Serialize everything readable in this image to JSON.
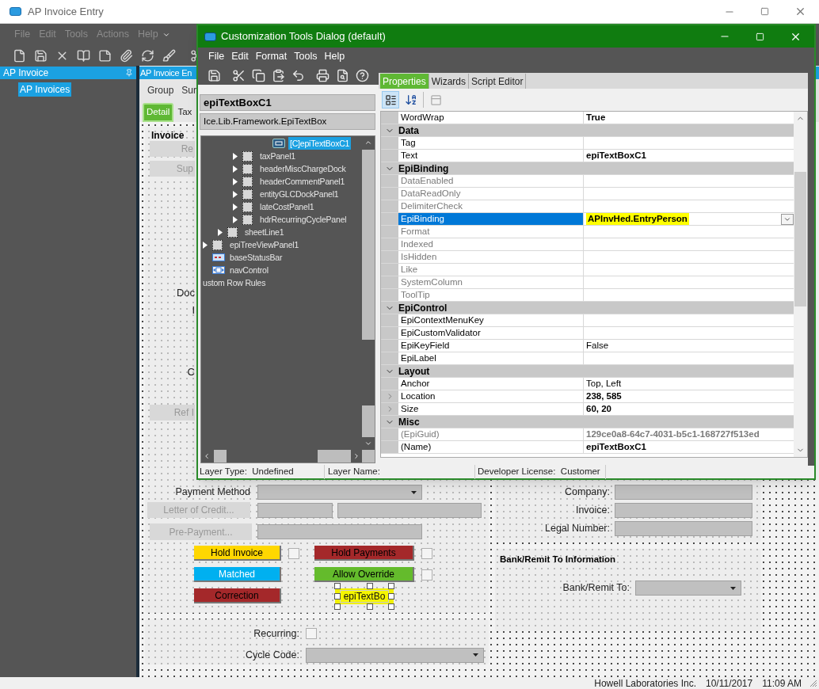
{
  "app_window": {
    "title": "AP Invoice Entry",
    "menu": [
      "File",
      "Edit",
      "Tools",
      "Actions",
      "Help"
    ]
  },
  "navigator": {
    "title": "AP Invoice",
    "items": [
      {
        "label": "AP Invoices",
        "selected": true
      }
    ]
  },
  "form": {
    "title": "AP Invoice En",
    "toolbar": [
      "Group",
      "Sur"
    ],
    "tabs": [
      {
        "label": "Detail",
        "selected": true
      },
      {
        "label": "Tax",
        "selected": false
      }
    ],
    "invoice_group": {
      "title": "Invoice",
      "top_buttons": [
        "Re",
        "Sup"
      ],
      "labels": [
        "Doc",
        "I",
        "C"
      ],
      "bottom_button": "Ref I"
    },
    "payment_method": {
      "label": "Payment Method"
    },
    "letter_of_credit": {
      "label": "Letter of Credit..."
    },
    "pre_payment": {
      "label": "Pre-Payment..."
    },
    "status_buttons": [
      {
        "label": "Hold Invoice",
        "color": "#ffd700",
        "kind": "with-checkbox",
        "checked": false
      },
      {
        "label": "Hold Payments",
        "color": "#a4282a",
        "kind": "with-checkbox",
        "checked": false
      },
      {
        "label": "Matched",
        "color": "#00b0f0",
        "kind": "plain"
      },
      {
        "label": "Allow Override",
        "color": "#64bb2c",
        "kind": "with-checkbox",
        "checked": false
      },
      {
        "label": "Correction",
        "color": "#a4282a",
        "kind": "plain"
      }
    ],
    "designer_textbox": {
      "text": "epiTextBo",
      "selected": true,
      "highlighted": true
    },
    "recurring": {
      "label": "Recurring:",
      "checked": false
    },
    "cycle_code": {
      "label": "Cycle Code:"
    },
    "references": [
      {
        "label": "Company:"
      },
      {
        "label": "Invoice:"
      },
      {
        "label": "Legal Number:"
      }
    ],
    "bank_remit": {
      "title": "Bank/Remit To Information",
      "label": "Bank/Remit To:"
    }
  },
  "status_bar": [
    "Howell Laboratories Inc.",
    "10/11/2017",
    "11:09 AM"
  ],
  "dialog": {
    "title": "Customization Tools Dialog (default)",
    "menu": [
      "File",
      "Edit",
      "Format",
      "Tools",
      "Help"
    ],
    "control_name": "epiTextBoxC1",
    "control_type": "Ice.Lib.Framework.EpiTextBox",
    "tree": [
      {
        "children": [
          {
            "children": [
              {
                "children": [
                  {
                    "children": [
                      {
                        "children": [
                          {
                            "label": "[C]epiTextBoxC1",
                            "kind": "textbox",
                            "expandable": false,
                            "selected": true
                          }
                        ]
                      }
                    ]
                  },
                  {
                    "label": "taxPanel1",
                    "kind": "panel",
                    "expandable": true,
                    "selected": false
                  },
                  {
                    "label": "headerMiscChargeDock",
                    "kind": "panel",
                    "expandable": true,
                    "selected": false
                  },
                  {
                    "label": "headerCommentPanel1",
                    "kind": "panel",
                    "expandable": true,
                    "selected": false
                  },
                  {
                    "label": "entityGLCDockPanel1",
                    "kind": "panel",
                    "expandable": true,
                    "selected": false
                  },
                  {
                    "label": "lateCostPanel1",
                    "kind": "panel",
                    "expandable": true,
                    "selected": false
                  },
                  {
                    "label": "hdrRecurringCyclePanel",
                    "kind": "panel",
                    "expandable": true,
                    "selected": false
                  }
                ]
              },
              {
                "label": "sheetLine1",
                "kind": "panel",
                "expandable": true,
                "selected": false
              }
            ]
          },
          {
            "label": "epiTreeViewPanel1",
            "kind": "panel",
            "expandable": true,
            "selected": false
          },
          {
            "label": "baseStatusBar",
            "kind": "statusbar",
            "expandable": false,
            "selected": false
          },
          {
            "label": "navControl",
            "kind": "navigator",
            "expandable": false,
            "selected": false
          }
        ]
      },
      {
        "label": "ustom Row Rules",
        "kind": "rules",
        "expandable": false,
        "selected": false
      }
    ],
    "tabs": [
      {
        "label": "Properties",
        "selected": true
      },
      {
        "label": "Wizards",
        "selected": false
      },
      {
        "label": "Script Editor",
        "selected": false
      }
    ],
    "properties": [
      {
        "kind": "property",
        "name": "WordWrap",
        "value": "True",
        "dimmed": false,
        "bold": true,
        "expandable": false,
        "selected": false,
        "highlighted": false
      },
      {
        "kind": "category",
        "name": "Data"
      },
      {
        "kind": "property",
        "name": "Tag",
        "dimmed": false,
        "expandable": false,
        "selected": false
      },
      {
        "kind": "property",
        "name": "Text",
        "value": "epiTextBoxC1",
        "dimmed": false,
        "bold": true,
        "expandable": false,
        "selected": false,
        "highlighted": false
      },
      {
        "kind": "category",
        "name": "EpiBinding"
      },
      {
        "kind": "property",
        "name": "DataEnabled",
        "dimmed": true,
        "expandable": false,
        "selected": false
      },
      {
        "kind": "property",
        "name": "DataReadOnly",
        "dimmed": true,
        "expandable": false,
        "selected": false
      },
      {
        "kind": "property",
        "name": "DelimiterCheck",
        "dimmed": true,
        "expandable": false,
        "selected": false
      },
      {
        "kind": "property",
        "name": "EpiBinding",
        "value": "APInvHed.EntryPerson",
        "dimmed": false,
        "bold": true,
        "expandable": false,
        "selected": true,
        "highlighted": true
      },
      {
        "kind": "property",
        "name": "Format",
        "dimmed": true,
        "expandable": false,
        "selected": false
      },
      {
        "kind": "property",
        "name": "Indexed",
        "dimmed": true,
        "expandable": false,
        "selected": false
      },
      {
        "kind": "property",
        "name": "IsHidden",
        "dimmed": true,
        "expandable": false,
        "selected": false
      },
      {
        "kind": "property",
        "name": "Like",
        "dimmed": true,
        "expandable": false,
        "selected": false
      },
      {
        "kind": "property",
        "name": "SystemColumn",
        "dimmed": true,
        "expandable": false,
        "selected": false
      },
      {
        "kind": "property",
        "name": "ToolTip",
        "dimmed": true,
        "expandable": false,
        "selected": false
      },
      {
        "kind": "category",
        "name": "EpiControl"
      },
      {
        "kind": "property",
        "name": "EpiContextMenuKey",
        "dimmed": false,
        "expandable": false,
        "selected": false
      },
      {
        "kind": "property",
        "name": "EpiCustomValidator",
        "dimmed": false,
        "expandable": false,
        "selected": false
      },
      {
        "kind": "property",
        "name": "EpiKeyField",
        "value": "False",
        "dimmed": false,
        "bold": false,
        "expandable": false,
        "selected": false,
        "highlighted": false
      },
      {
        "kind": "property",
        "name": "EpiLabel",
        "dimmed": false,
        "expandable": false,
        "selected": false
      },
      {
        "kind": "category",
        "name": "Layout"
      },
      {
        "kind": "property",
        "name": "Anchor",
        "value": "Top, Left",
        "dimmed": false,
        "bold": false,
        "expandable": false,
        "selected": false,
        "highlighted": false
      },
      {
        "kind": "property",
        "name": "Location",
        "value": "238, 585",
        "dimmed": false,
        "bold": true,
        "expandable": true,
        "selected": false,
        "highlighted": false
      },
      {
        "kind": "property",
        "name": "Size",
        "value": "60, 20",
        "dimmed": false,
        "bold": true,
        "expandable": true,
        "selected": false,
        "highlighted": false
      },
      {
        "kind": "category",
        "name": "Misc"
      },
      {
        "kind": "property",
        "name": "(EpiGuid)",
        "value": "129ce0a8-64c7-4031-b5c1-168727f513ed",
        "dimmed": true,
        "bold": true,
        "expandable": false,
        "selected": false,
        "highlighted": false
      },
      {
        "kind": "property",
        "name": "(Name)",
        "value": "epiTextBoxC1",
        "dimmed": false,
        "bold": true,
        "expandable": false,
        "selected": false,
        "highlighted": false
      }
    ],
    "status": [
      "Layer Type:  Undefined",
      "Layer Name:",
      "Developer License:  Customer"
    ]
  }
}
